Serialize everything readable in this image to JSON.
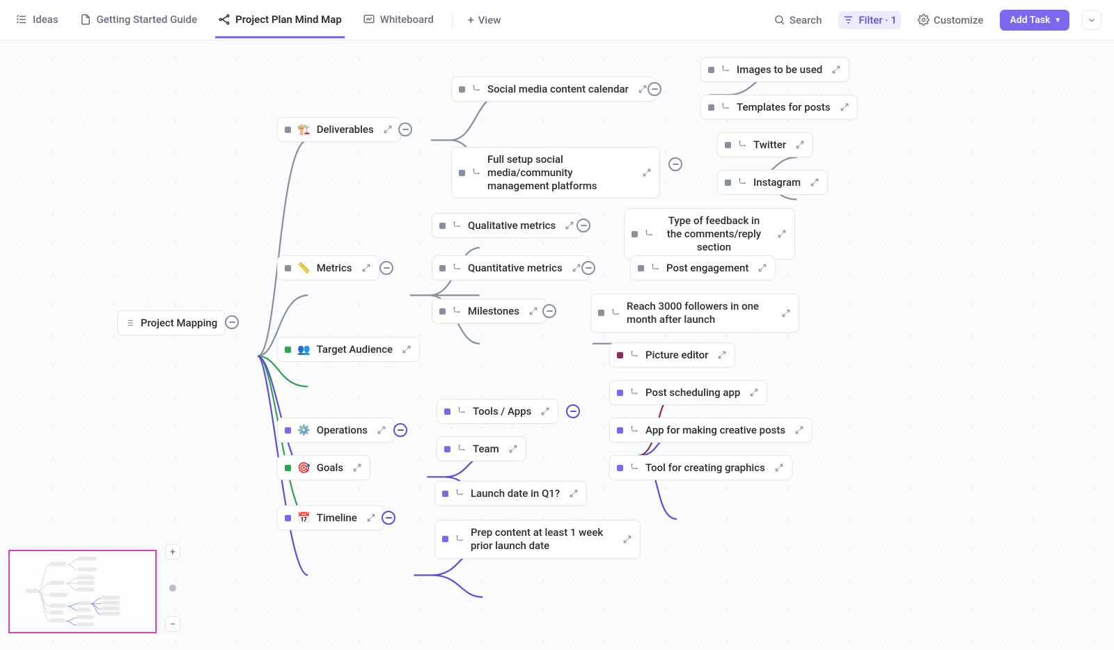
{
  "toolbar": {
    "tabs": [
      {
        "id": "ideas",
        "label": "Ideas"
      },
      {
        "id": "guide",
        "label": "Getting Started Guide"
      },
      {
        "id": "mindmap",
        "label": "Project Plan Mind Map",
        "active": true
      },
      {
        "id": "whiteboard",
        "label": "Whiteboard"
      }
    ],
    "add_view_label": "View",
    "search_label": "Search",
    "filter_label": "Filter",
    "filter_count": "1",
    "customize_label": "Customize",
    "add_task_label": "Add Task"
  },
  "nodes": {
    "root": {
      "label": "Project Mapping"
    },
    "deliverables": {
      "emoji": "🏗️",
      "label": "Deliverables"
    },
    "metrics": {
      "emoji": "📏",
      "label": "Metrics"
    },
    "target_audience": {
      "emoji": "👥",
      "label": "Target Audience"
    },
    "operations": {
      "emoji": "⚙️",
      "label": "Operations"
    },
    "goals": {
      "emoji": "🎯",
      "label": "Goals"
    },
    "timeline": {
      "emoji": "📅",
      "label": "Timeline"
    },
    "social_calendar": {
      "label": "Social media content calendar"
    },
    "images_used": {
      "label": "Images to be used"
    },
    "templates_posts": {
      "label": "Templates for posts"
    },
    "full_setup": {
      "label": "Full setup social media/community management platforms"
    },
    "twitter": {
      "label": "Twitter"
    },
    "instagram": {
      "label": "Instagram"
    },
    "qualitative": {
      "label": "Qualitative metrics"
    },
    "feedback_type": {
      "label": "Type of feedback in the comments/reply section"
    },
    "quantitative": {
      "label": "Quantitative metrics"
    },
    "post_engagement": {
      "label": "Post engagement"
    },
    "milestones": {
      "label": "Milestones"
    },
    "reach_followers": {
      "label": "Reach 3000 followers in one month after launch"
    },
    "tools_apps": {
      "label": "Tools / Apps"
    },
    "team": {
      "label": "Team"
    },
    "picture_editor": {
      "label": "Picture editor"
    },
    "post_sched": {
      "label": "Post scheduling app"
    },
    "creative_posts": {
      "label": "App for making creative posts"
    },
    "graphics_tool": {
      "label": "Tool for creating graphics"
    },
    "launch_q1": {
      "label": "Launch date in Q1?"
    },
    "prep_content": {
      "label": "Prep content at least 1 week prior launch date"
    }
  }
}
